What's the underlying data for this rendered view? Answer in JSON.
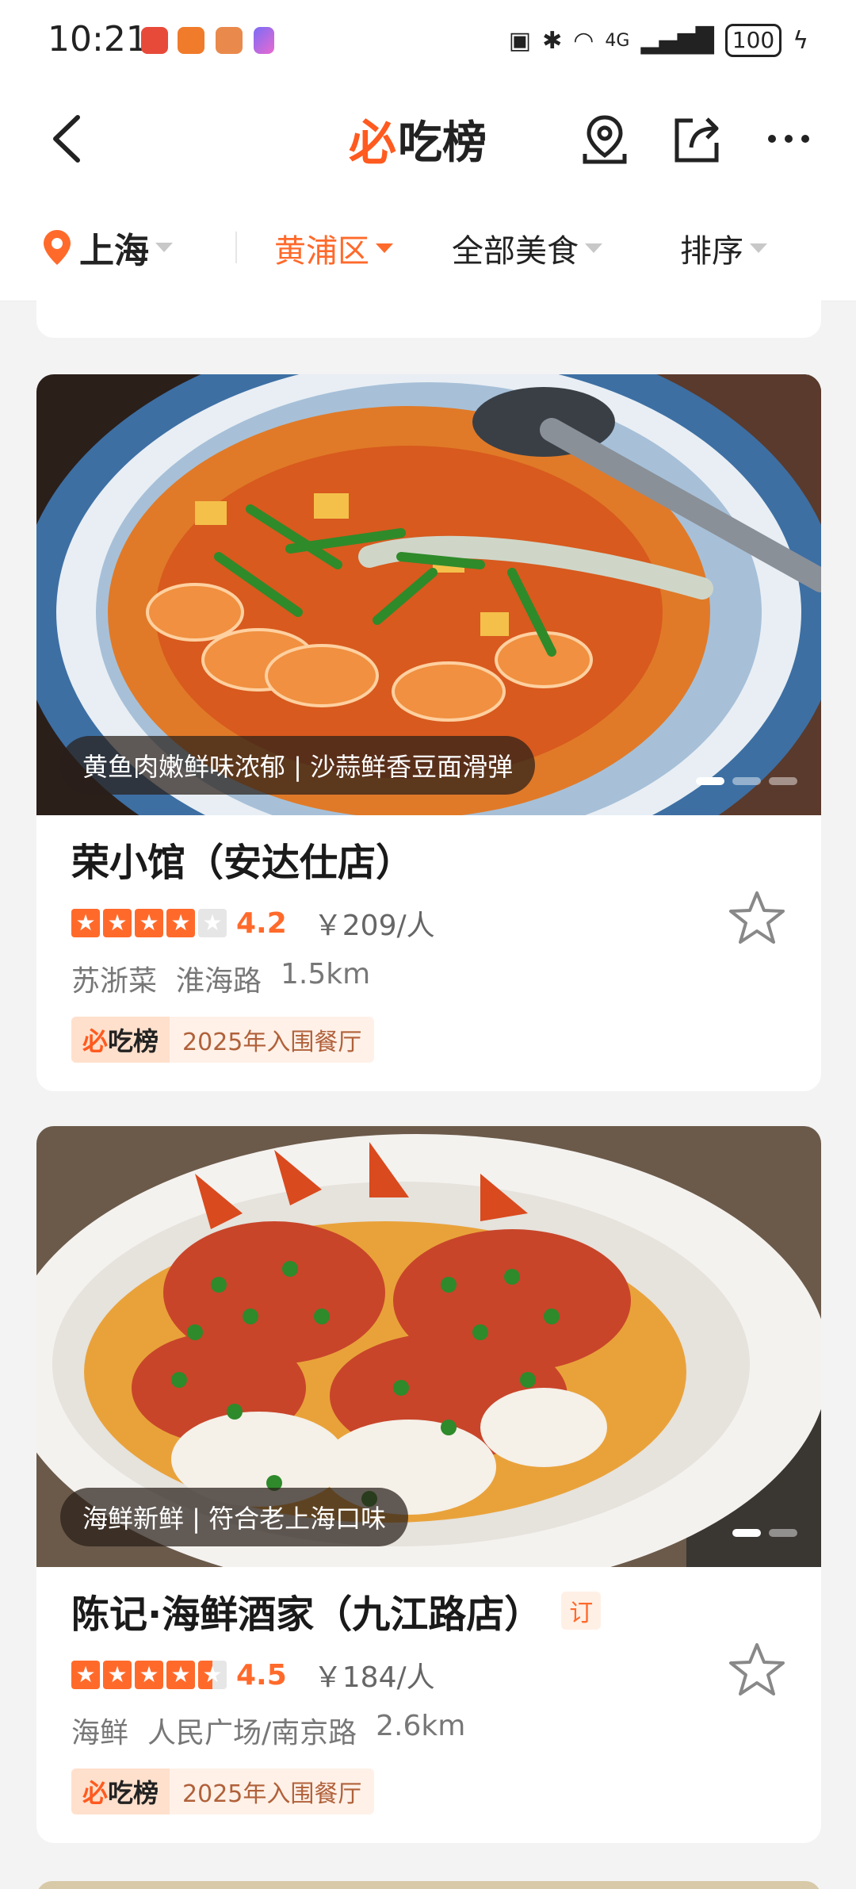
{
  "status_bar": {
    "time": "10:21",
    "battery": "100",
    "network": "4G"
  },
  "nav": {
    "logo_text": "吃榜",
    "logo_mark": "必"
  },
  "filters": {
    "city": "上海",
    "district": "黄浦区",
    "category": "全部美食",
    "sort": "排序"
  },
  "colors": {
    "accent": "#ff6a2b",
    "background": "#f3f3f3"
  },
  "restaurants": [
    {
      "caption": "黄鱼肉嫩鲜味浓郁 | 沙蒜鲜香豆面滑弹",
      "name": "荣小馆（安达仕店）",
      "stars": 4.2,
      "score": "4.2",
      "price": "￥209/人",
      "cuisine": "苏浙菜",
      "area": "淮海路",
      "distance": "1.5km",
      "award_logo_mark": "必",
      "award_logo_text": "吃榜",
      "award_text": "2025年入围餐厅",
      "photo_dots": 3,
      "active_dot": 0
    },
    {
      "caption": "海鲜新鲜 | 符合老上海口味",
      "name": "陈记·海鲜酒家（九江路店）",
      "badge": "订",
      "stars": 4.5,
      "score": "4.5",
      "price": "￥184/人",
      "cuisine": "海鲜",
      "area": "人民广场/南京路",
      "distance": "2.6km",
      "award_logo_mark": "必",
      "award_logo_text": "吃榜",
      "award_text": "2025年入围餐厅",
      "photo_dots": 2,
      "active_dot": 0
    }
  ]
}
